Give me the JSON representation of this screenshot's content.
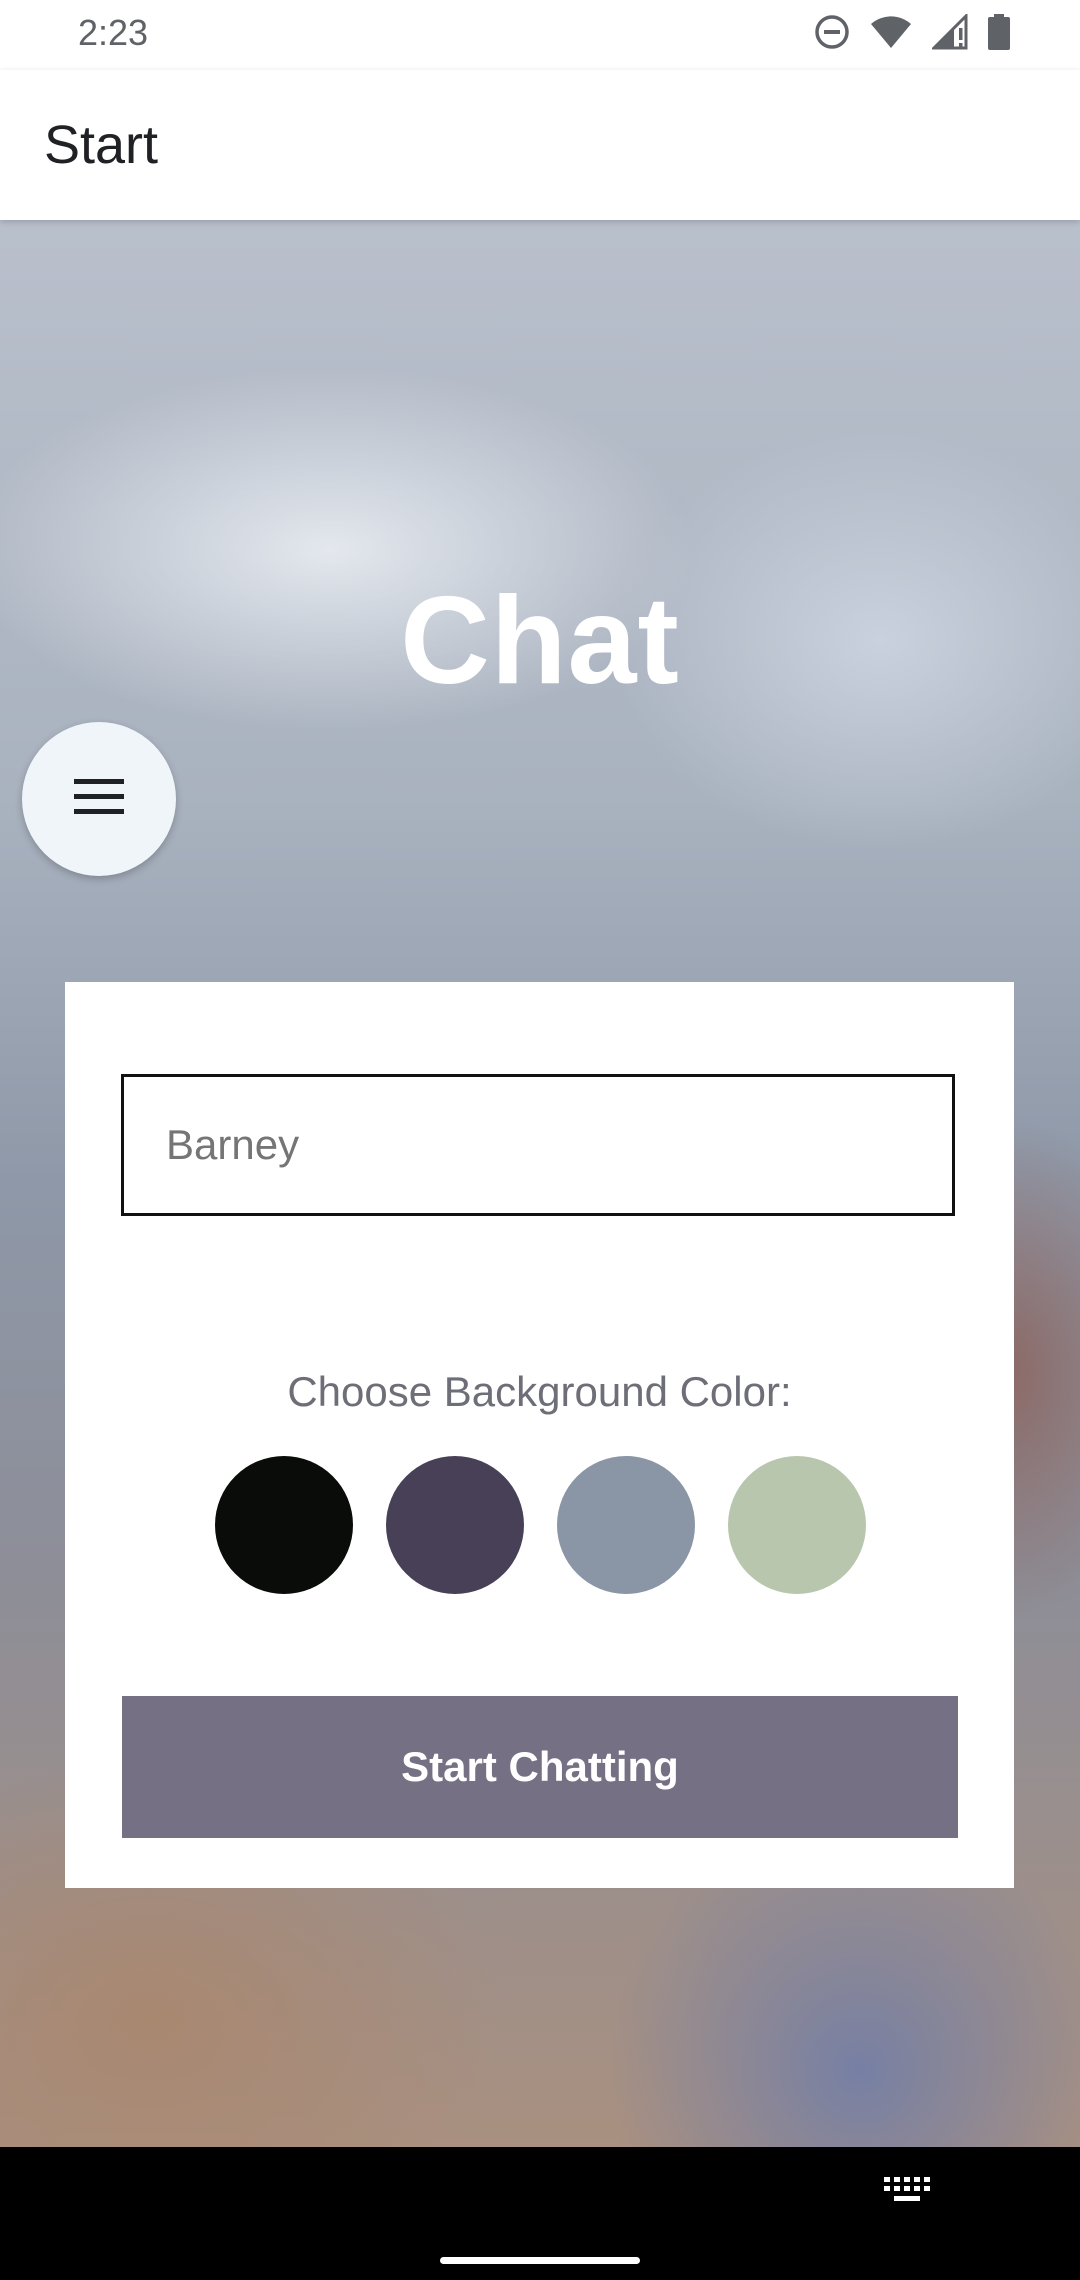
{
  "status_bar": {
    "time": "2:23",
    "icons": [
      "do-not-disturb-icon",
      "wifi-icon",
      "signal-icon",
      "battery-icon"
    ]
  },
  "app_bar": {
    "title": "Start"
  },
  "hero": {
    "title": "Chat",
    "menu_icon": "menu-icon"
  },
  "form": {
    "name_input": {
      "value": "",
      "placeholder": "Barney"
    },
    "color_label": "Choose Background Color:",
    "colors": [
      "#090C08",
      "#474056",
      "#8A95A5",
      "#B9C6AE"
    ],
    "start_button": {
      "label": "Start Chatting",
      "color": "#757083"
    }
  },
  "nav_bar": {
    "keyboard_icon": "keyboard-icon"
  }
}
